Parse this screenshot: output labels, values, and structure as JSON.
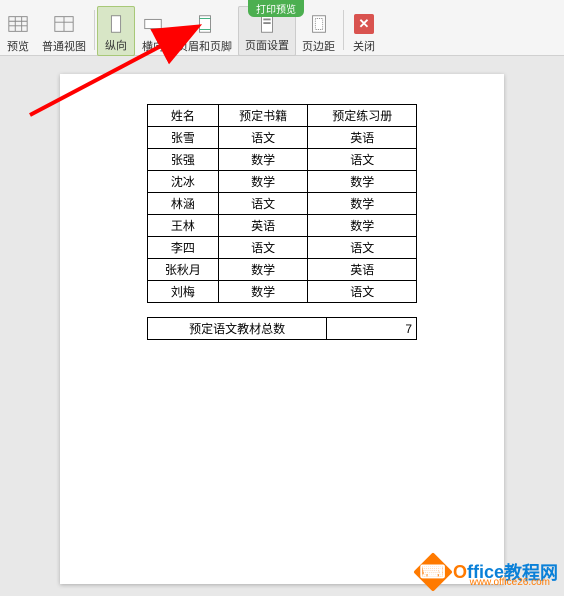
{
  "badge": "打印预览",
  "toolbar": {
    "preview": "预览",
    "normal_view": "普通视图",
    "portrait": "纵向",
    "landscape": "横向",
    "header_footer": "页眉和页脚",
    "page_setup": "页面设置",
    "margins": "页边距",
    "close": "关闭"
  },
  "table": {
    "headers": [
      "姓名",
      "预定书籍",
      "预定练习册"
    ],
    "rows": [
      [
        "张雪",
        "语文",
        "英语"
      ],
      [
        "张强",
        "数学",
        "语文"
      ],
      [
        "沈冰",
        "数学",
        "数学"
      ],
      [
        "林涵",
        "语文",
        "数学"
      ],
      [
        "王林",
        "英语",
        "数学"
      ],
      [
        "李四",
        "语文",
        "语文"
      ],
      [
        "张秋月",
        "数学",
        "英语"
      ],
      [
        "刘梅",
        "数学",
        "语文"
      ]
    ]
  },
  "summary": {
    "label": "预定语文教材总数",
    "value": "7"
  },
  "watermark": {
    "brand_prefix": "O",
    "brand_mid": "ffice",
    "brand_suffix": "教程网",
    "url": "www.office26.com"
  }
}
